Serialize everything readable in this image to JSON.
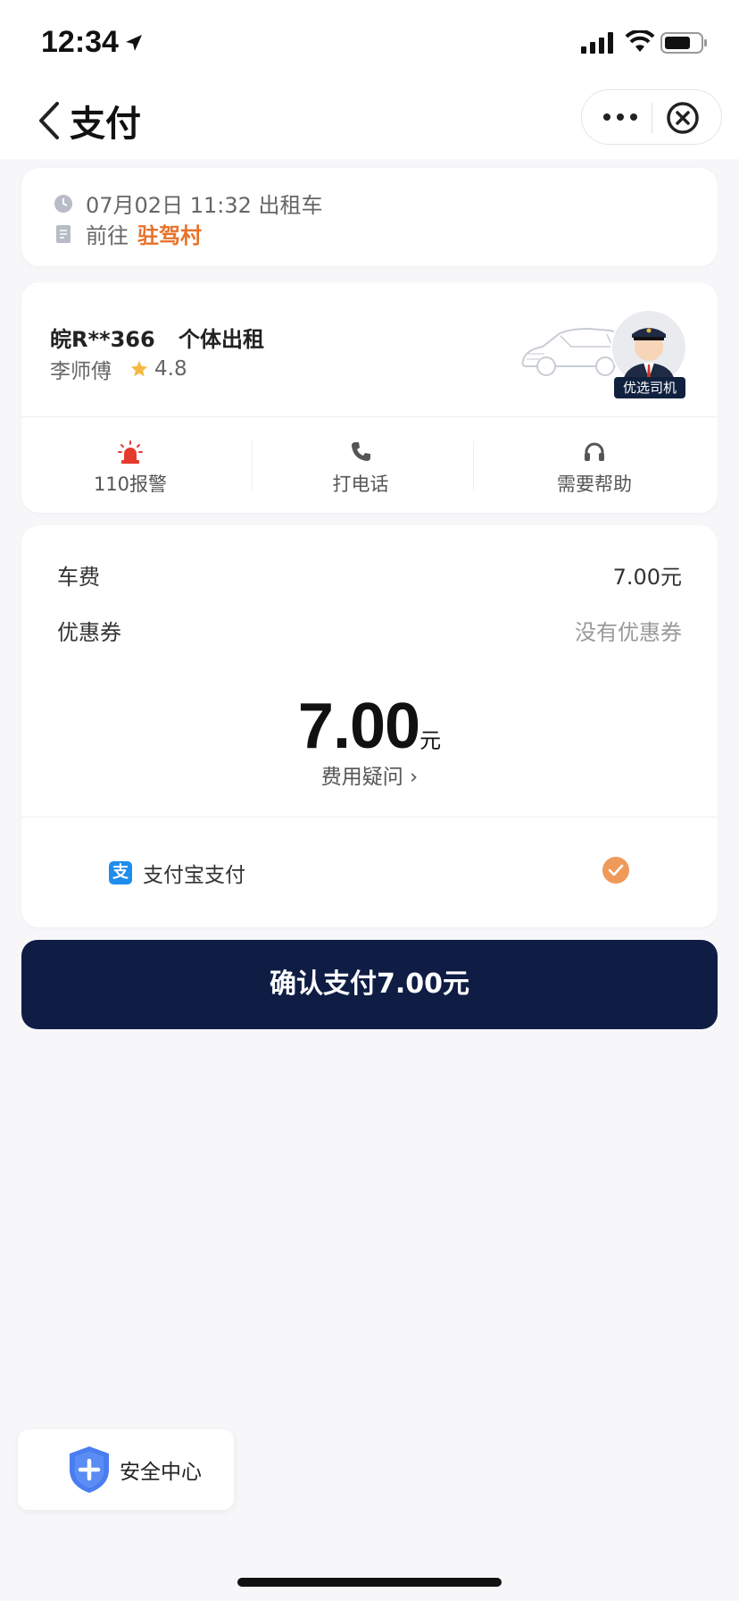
{
  "status_bar": {
    "time": "12:34"
  },
  "nav": {
    "title": "支付"
  },
  "trip": {
    "datetime": "07月02日 11:32 出租车",
    "to_label": "前往",
    "destination": "驻驾村"
  },
  "driver": {
    "plate": "皖R**366",
    "car_type": "个体出租",
    "name": "李师傅",
    "rating": "4.8",
    "badge": "优选司机"
  },
  "actions": [
    {
      "label": "110报警",
      "icon": "alarm-icon"
    },
    {
      "label": "打电话",
      "icon": "phone-icon"
    },
    {
      "label": "需要帮助",
      "icon": "headset-icon"
    }
  ],
  "payment": {
    "fare_label": "车费",
    "fare_value": "7.00元",
    "coupon_label": "优惠券",
    "coupon_value": "没有优惠券",
    "total_amount": "7.00",
    "total_unit": "元",
    "fee_question": "费用疑问 ›",
    "method_label": "支付宝支付",
    "alipay_glyph": "支"
  },
  "confirm": {
    "label": "确认支付7.00元"
  },
  "safety": {
    "label": "安全中心"
  },
  "colors": {
    "accent_orange": "#e8722a",
    "button_navy": "#0f1d45",
    "check_orange": "#ef9a5b",
    "alipay_blue": "#1f8ded",
    "alarm_red": "#e63a2f"
  }
}
